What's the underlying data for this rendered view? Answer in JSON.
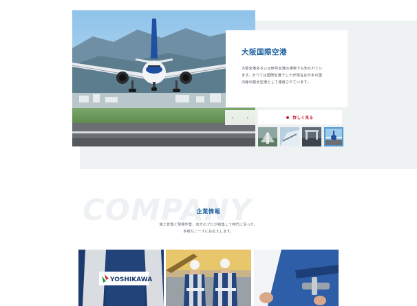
{
  "feature": {
    "title": "大阪国際空港",
    "description_lines": [
      "大阪空港あるいは伊丹空港の通称でも知られてい",
      "ます。かつては国際空港でしたが現在は日本の国",
      "内線の拠点空港として運用されています。"
    ],
    "more_label": "詳しく見る",
    "prev_arrow": "‹",
    "next_arrow": "›"
  },
  "thumbnails": [
    "thumb-1",
    "thumb-2",
    "thumb-3",
    "thumb-4"
  ],
  "company": {
    "watermark": "COMPANY",
    "title": "企業情報",
    "description_lines": [
      "施工管理と現場作業、双方のプロが結集して時代に沿った、",
      "多様なニーズにお応えします。"
    ],
    "vest_logo": "YOSHIKAWA"
  },
  "colors": {
    "accent_blue": "#1b5f9c",
    "accent_red": "#c82236",
    "panel_grey": "#eef2f3"
  }
}
